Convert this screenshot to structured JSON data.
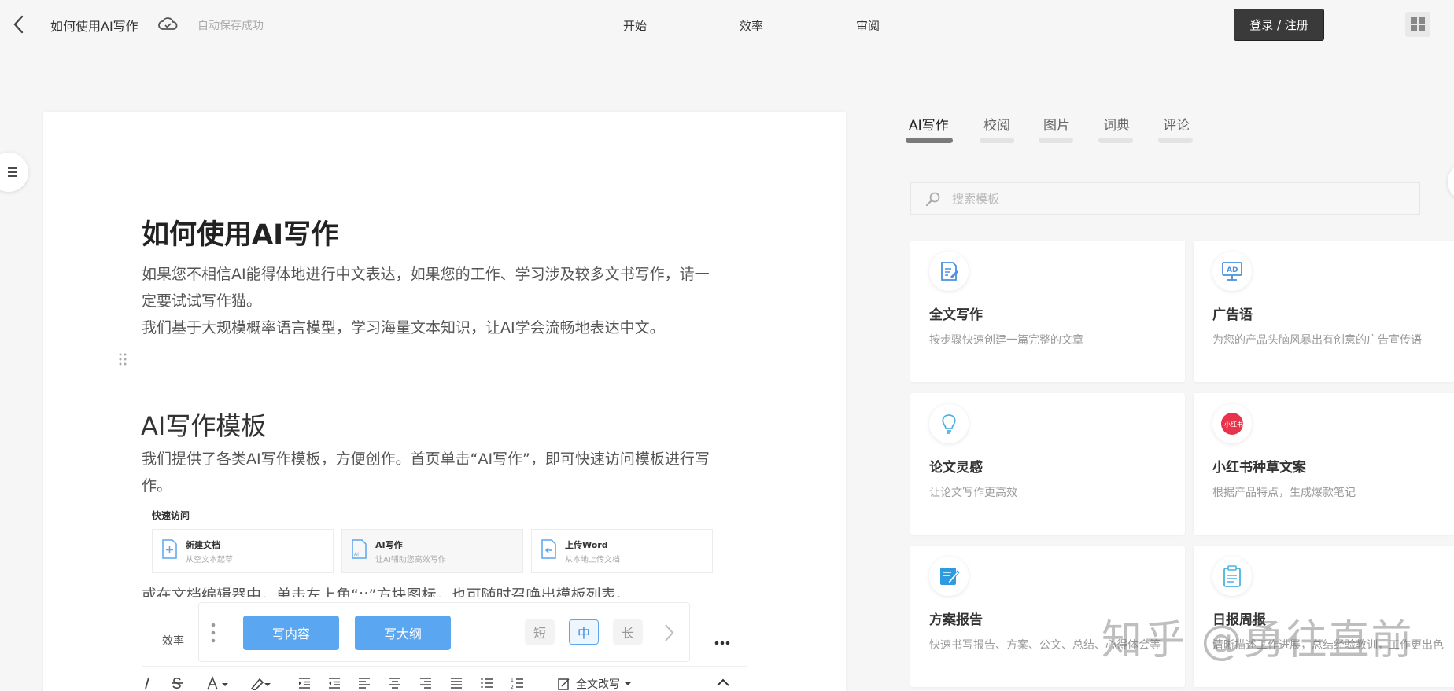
{
  "header": {
    "doc_title": "如何使用AI写作",
    "save_status": "自动保存成功",
    "nav": [
      "开始",
      "效率",
      "审阅"
    ],
    "login_label": "登录 / 注册"
  },
  "document": {
    "title": "如何使用AI写作",
    "paragraph1_line1": "如果您不相信AI能得体地进行中文表达，如果您的工作、学习涉及较多文书写作，请一",
    "paragraph1_line2": "定要试试写作猫。",
    "paragraph2": "我们基于大规模概率语言模型，学习海量文本知识，让AI学会流畅地表达中文。",
    "section_title": "AI写作模板",
    "paragraph3_line1": "我们提供了各类AI写作模板，方便创作。首页单击“AI写作”，即可快速访问模板进行写",
    "paragraph3_line2": "作。",
    "quick_access": {
      "title": "快速访问",
      "items": [
        {
          "name": "新建文档",
          "desc": "从空文本起草"
        },
        {
          "name": "AI写作",
          "desc": "让AI辅助您高效写作"
        },
        {
          "name": "上传Word",
          "desc": "从本地上传文档"
        }
      ]
    },
    "paragraph4_partial": "或在文档编辑器中，单击左上角“::”方块图标，也可随时召唤出模板列表。"
  },
  "float_toolbar": {
    "label": "效率",
    "write_content": "写内容",
    "write_outline": "写大纲",
    "length_short": "短",
    "length_medium": "中",
    "length_long": "长",
    "selected_length": "中",
    "more": "..."
  },
  "format_bar": {
    "rewrite_all": "全文改写"
  },
  "right_panel": {
    "tabs": [
      "AI写作",
      "校阅",
      "图片",
      "词典",
      "评论"
    ],
    "active_tab": "AI写作",
    "search_placeholder": "搜索模板",
    "templates": [
      {
        "title": "全文写作",
        "desc": "按步骤快速创建一篇完整的文章",
        "icon": "edit-doc-icon"
      },
      {
        "title": "广告语",
        "desc": "为您的产品头脑风暴出有创意的广告宣传语",
        "icon": "ad-board-icon"
      },
      {
        "title": "论文灵感",
        "desc": "让论文写作更高效",
        "icon": "lightbulb-icon"
      },
      {
        "title": "小红书种草文案",
        "desc": "根据产品特点，生成爆款笔记",
        "icon": "xiaohongshu-icon"
      },
      {
        "title": "方案报告",
        "desc": "快速书写报告、方案、公文、总结、心得体会等",
        "icon": "report-pen-icon"
      },
      {
        "title": "日报周报",
        "desc": "清晰描述工作进展，总结经验教训，工作更出色",
        "icon": "clipboard-icon"
      }
    ]
  },
  "watermark": "知乎 @勇往直前",
  "colors": {
    "accent_blue": "#5aa6f0",
    "login_dark": "#3a3a3a",
    "xiaohongshu_red": "#e8334a"
  }
}
